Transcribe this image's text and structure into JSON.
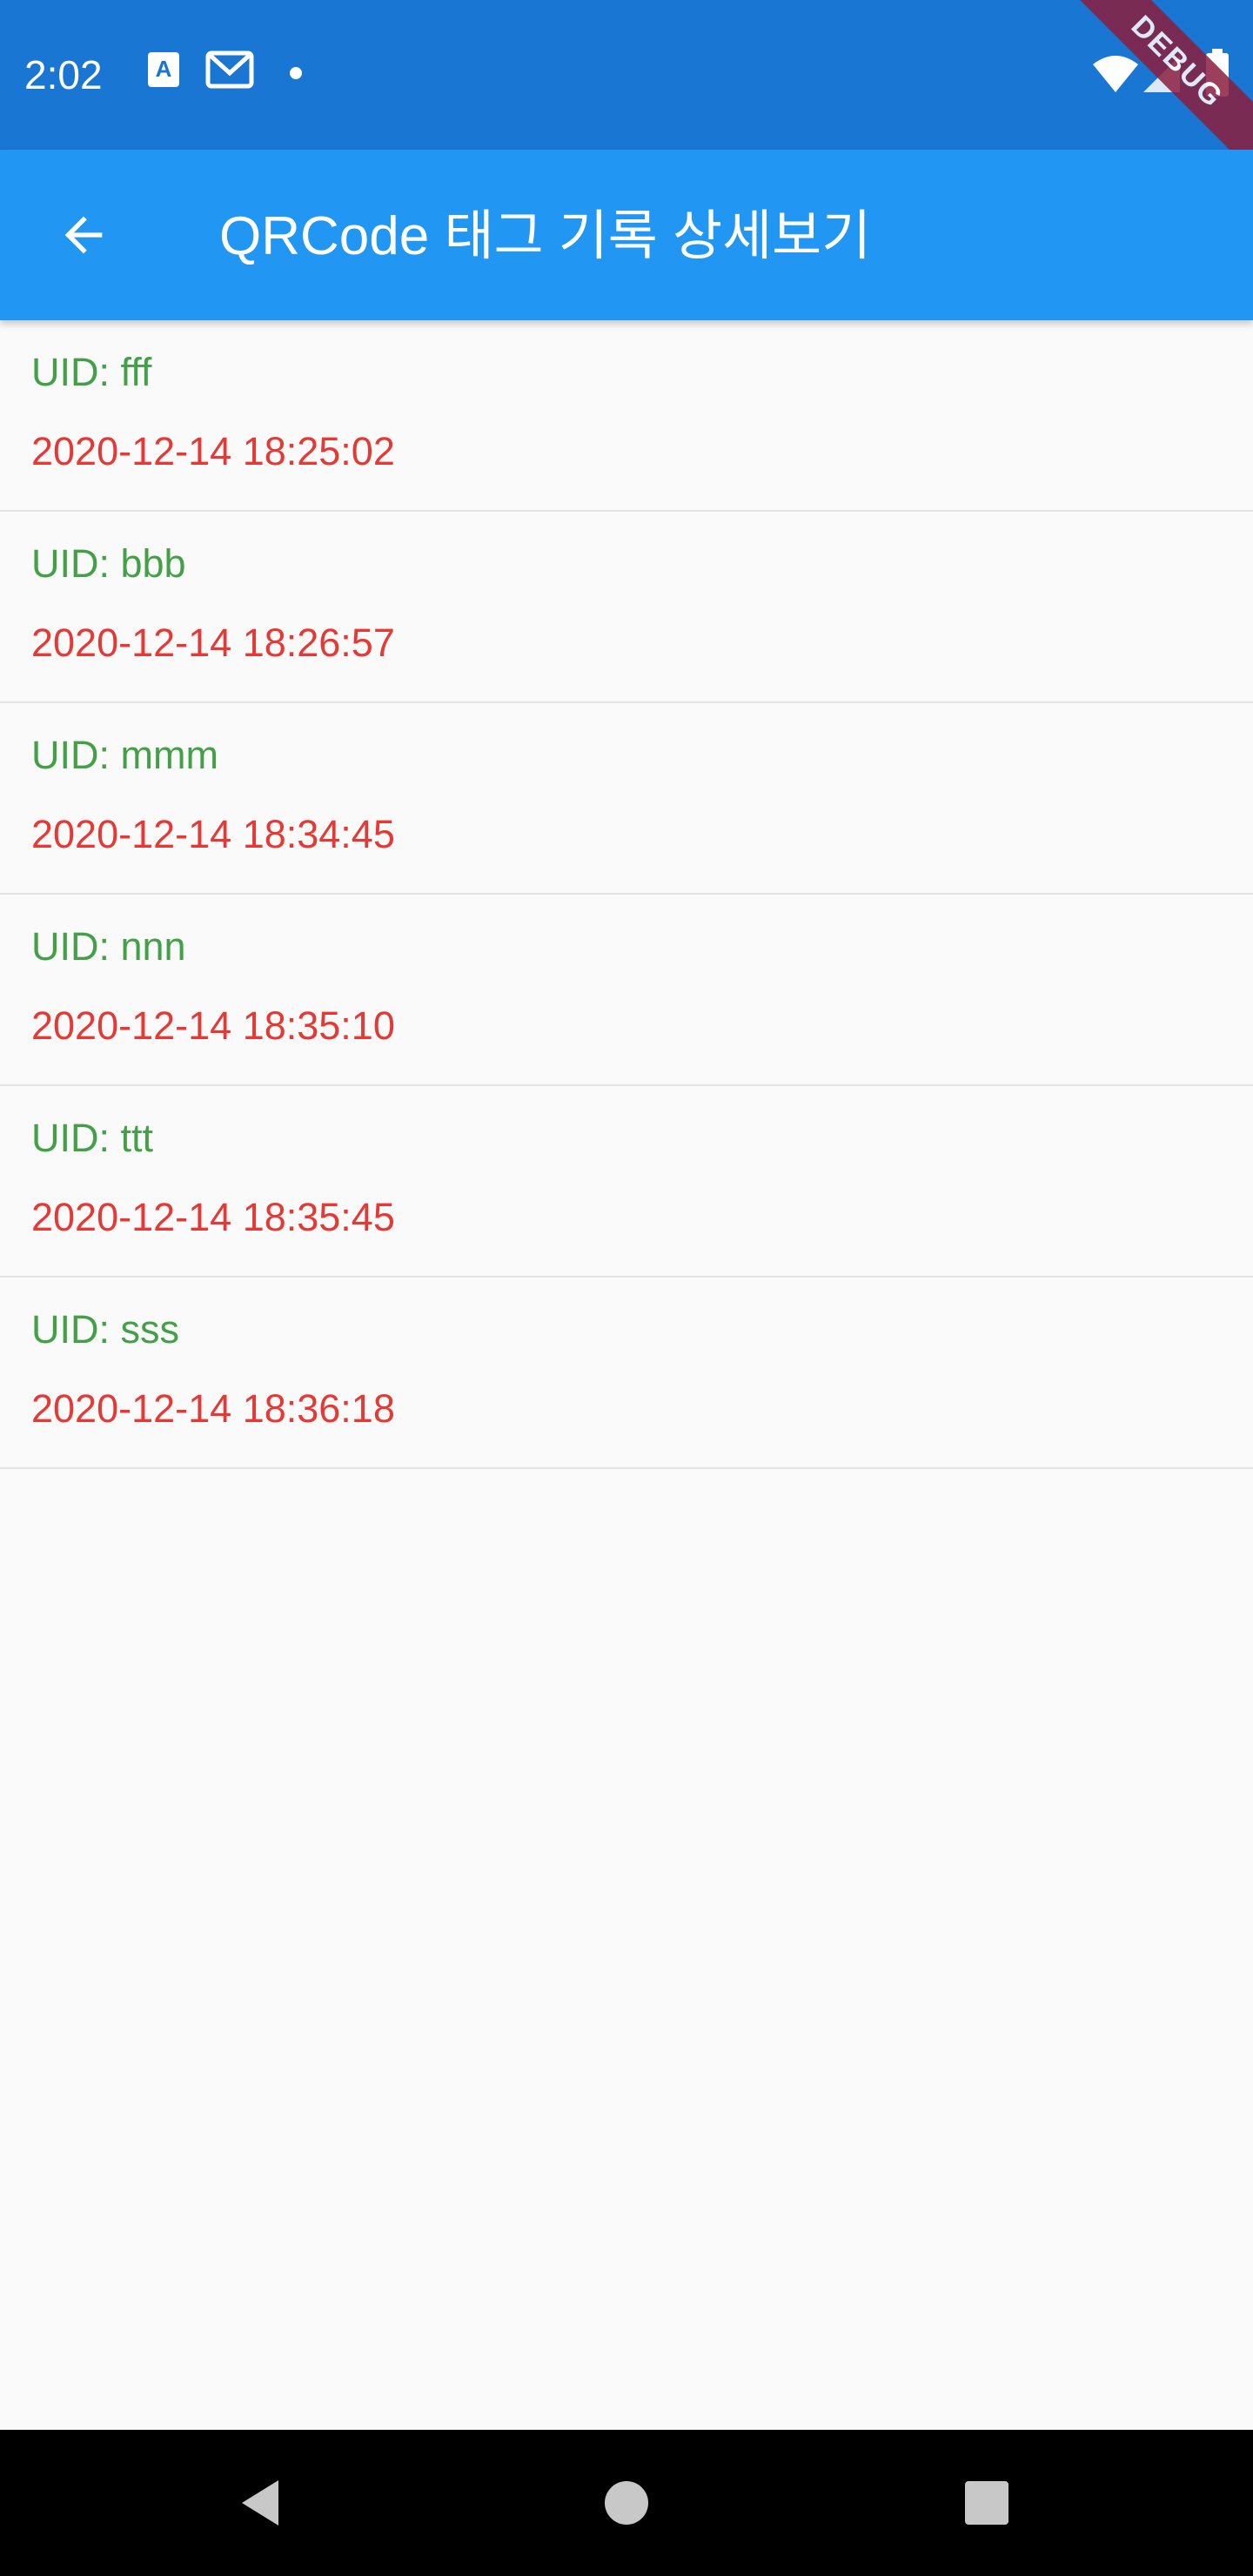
{
  "status_bar": {
    "time": "2:02",
    "icons": [
      "text-notification-icon",
      "gmail-icon",
      "dot-icon",
      "wifi-icon",
      "signal-icon",
      "battery-icon"
    ]
  },
  "debug_banner": "DEBUG",
  "app_bar": {
    "title": "QRCode 태그 기록 상세보기",
    "back_icon": "arrow-back-icon"
  },
  "colors": {
    "status_bar": "#1976d2",
    "app_bar": "#2196f3",
    "uid_text": "#43a047",
    "timestamp_text": "#e53935",
    "background": "#fafafa"
  },
  "records": [
    {
      "uid": "UID: fff",
      "time": "2020-12-14 18:25:02"
    },
    {
      "uid": "UID: bbb",
      "time": "2020-12-14 18:26:57"
    },
    {
      "uid": "UID: mmm",
      "time": "2020-12-14 18:34:45"
    },
    {
      "uid": "UID: nnn",
      "time": "2020-12-14 18:35:10"
    },
    {
      "uid": "UID: ttt",
      "time": "2020-12-14 18:35:45"
    },
    {
      "uid": "UID: sss",
      "time": "2020-12-14 18:36:18"
    }
  ],
  "nav_bar": {
    "buttons": [
      "back-triangle-icon",
      "home-circle-icon",
      "recents-square-icon"
    ]
  }
}
